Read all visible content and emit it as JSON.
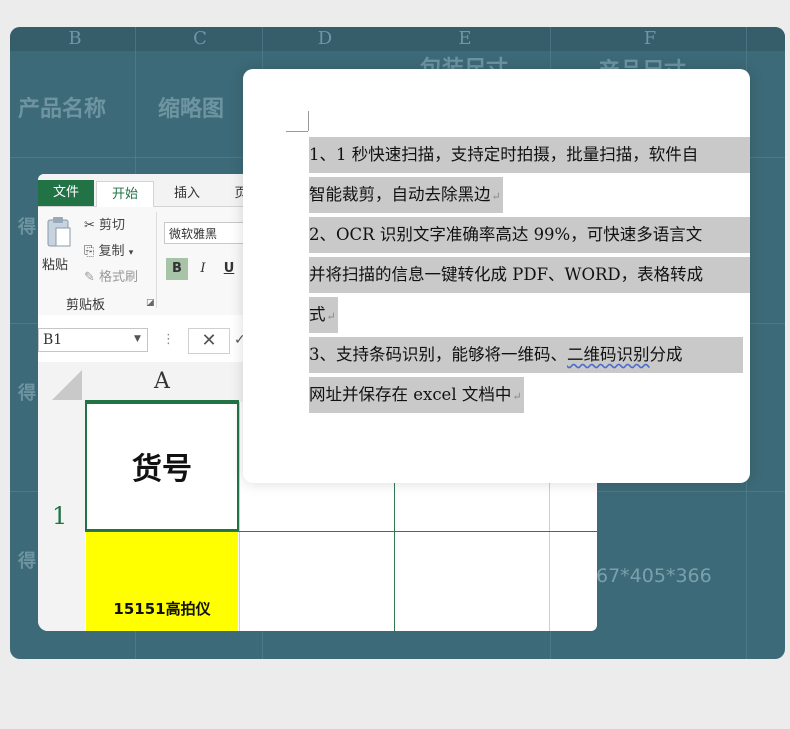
{
  "background_sheet": {
    "columns": [
      "B",
      "C",
      "D",
      "E",
      "F"
    ],
    "headers": [
      "产品名称",
      "缩略图",
      "包装尺寸",
      "产品尺寸"
    ],
    "row_labels": [
      "得",
      "得",
      "得"
    ],
    "value": "67*405*366"
  },
  "excel": {
    "tabs": {
      "file": "文件",
      "home": "开始",
      "insert": "插入",
      "view": "页"
    },
    "clipboard": {
      "paste": "粘贴",
      "cut": "剪切",
      "copy": "复制",
      "format_painter": "格式刷",
      "group_label": "剪贴板"
    },
    "font": {
      "name": "微软雅黑",
      "bold": "B",
      "italic": "I",
      "underline": "U"
    },
    "formula_bar": {
      "name_box": "B1"
    },
    "column_header": "A",
    "row_number": "1",
    "cells": {
      "a1": "货号",
      "a2": "15151高拍仪"
    }
  },
  "document": {
    "lines": [
      "1、1 秒快速扫描，支持定时拍摄，批量扫描，软件自",
      "智能裁剪，自动去除黑边",
      "2、OCR 识别文字准确率高达 99%，可快速多语言文",
      "并将扫描的信息一键转化成 PDF、WORD，表格转成",
      "式",
      "3、支持条码识别，能够将一维码、",
      "二维码识别",
      "分成",
      "网址并保存在 excel 文档中"
    ]
  },
  "colors": {
    "excel_green": "#217346",
    "highlight": "#c9c9c9",
    "yellow_cell": "#ffff00",
    "bg_teal": "#3d6a78"
  }
}
